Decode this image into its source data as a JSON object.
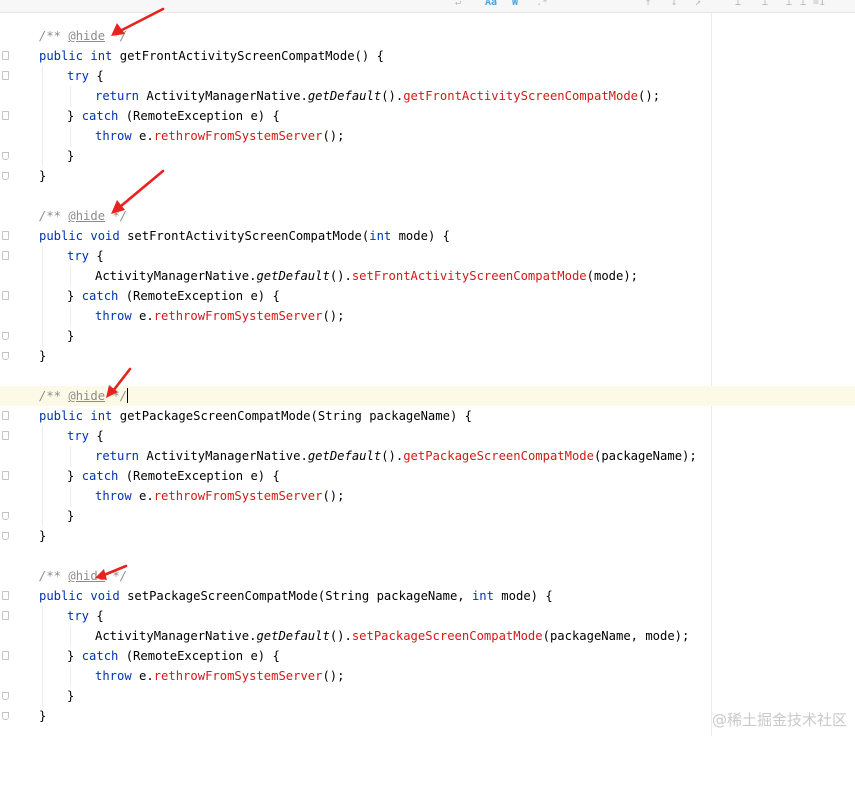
{
  "toolbar": {
    "items": [
      "↵",
      "Aa",
      "W",
      ".*",
      "↑",
      "↓",
      "↗",
      "⊥",
      "⊥",
      "⊥",
      "⊥",
      "=1"
    ]
  },
  "code": {
    "blocks": [
      {
        "comment_open": "/** ",
        "hide_tag": "@hide",
        "comment_close": " */",
        "sig_mod": "public",
        "sig_type": "int",
        "sig_name": "getFrontActivityScreenCompatMode",
        "sig_params_open": "(",
        "sig_params": "",
        "sig_params_close": ") {",
        "try_kw": "try",
        "try_brace": " {",
        "body_return": "return ",
        "body_class": "ActivityManagerNative.",
        "body_static": "getDefault",
        "body_dot": "().",
        "body_method": "getFrontActivityScreenCompatMode",
        "body_args": "();",
        "catch_close": "} ",
        "catch_kw": "catch",
        "catch_args": " (RemoteException e) {",
        "throw_kw": "throw",
        "throw_obj": " e.",
        "throw_method": "rethrowFromSystemServer",
        "throw_end": "();",
        "inner_close": "}",
        "outer_close": "}"
      },
      {
        "comment_open": "/** ",
        "hide_tag": "@hide",
        "comment_close": " */",
        "sig_mod": "public",
        "sig_type": "void",
        "sig_name": "setFrontActivityScreenCompatMode",
        "sig_params_open": "(",
        "sig_param_type": "int",
        "sig_params": " mode",
        "sig_params_close": ") {",
        "try_kw": "try",
        "try_brace": " {",
        "body_return": "",
        "body_class": "ActivityManagerNative.",
        "body_static": "getDefault",
        "body_dot": "().",
        "body_method": "setFrontActivityScreenCompatMode",
        "body_args": "(mode);",
        "catch_close": "} ",
        "catch_kw": "catch",
        "catch_args": " (RemoteException e) {",
        "throw_kw": "throw",
        "throw_obj": " e.",
        "throw_method": "rethrowFromSystemServer",
        "throw_end": "();",
        "inner_close": "}",
        "outer_close": "}"
      },
      {
        "comment_open": "/** ",
        "hide_tag": "@hide",
        "comment_close": " */",
        "sig_mod": "public",
        "sig_type": "int",
        "sig_name": "getPackageScreenCompatMode",
        "sig_params_open": "(",
        "sig_params": "String packageName",
        "sig_params_close": ") {",
        "try_kw": "try",
        "try_brace": " {",
        "body_return": "return ",
        "body_class": "ActivityManagerNative.",
        "body_static": "getDefault",
        "body_dot": "().",
        "body_method": "getPackageScreenCompatMode",
        "body_args": "(packageName);",
        "catch_close": "} ",
        "catch_kw": "catch",
        "catch_args": " (RemoteException e) {",
        "throw_kw": "throw",
        "throw_obj": " e.",
        "throw_method": "rethrowFromSystemServer",
        "throw_end": "();",
        "inner_close": "}",
        "outer_close": "}"
      },
      {
        "comment_open": "/** ",
        "hide_tag": "@hide",
        "comment_close": " */",
        "sig_mod": "public",
        "sig_type": "void",
        "sig_name": "setPackageScreenCompatMode",
        "sig_params_open": "(",
        "sig_params": "String packageName, ",
        "sig_param_type": "int",
        "sig_params_tail": " mode",
        "sig_params_close": ") {",
        "try_kw": "try",
        "try_brace": " {",
        "body_return": "",
        "body_class": "ActivityManagerNative.",
        "body_static": "getDefault",
        "body_dot": "().",
        "body_method": "setPackageScreenCompatMode",
        "body_args": "(packageName, mode);",
        "catch_close": "} ",
        "catch_kw": "catch",
        "catch_args": " (RemoteException e) {",
        "throw_kw": "throw",
        "throw_obj": " e.",
        "throw_method": "rethrowFromSystemServer",
        "throw_end": "();",
        "inner_close": "}",
        "outer_close": "}"
      }
    ]
  },
  "colors": {
    "keyword": "#0033b3",
    "comment": "#8c8c8c",
    "method_call": "#d4191a",
    "annotation_arrow": "#e8231f",
    "caret_line": "#fcfae6"
  },
  "watermark": "@稀土掘金技术社区"
}
